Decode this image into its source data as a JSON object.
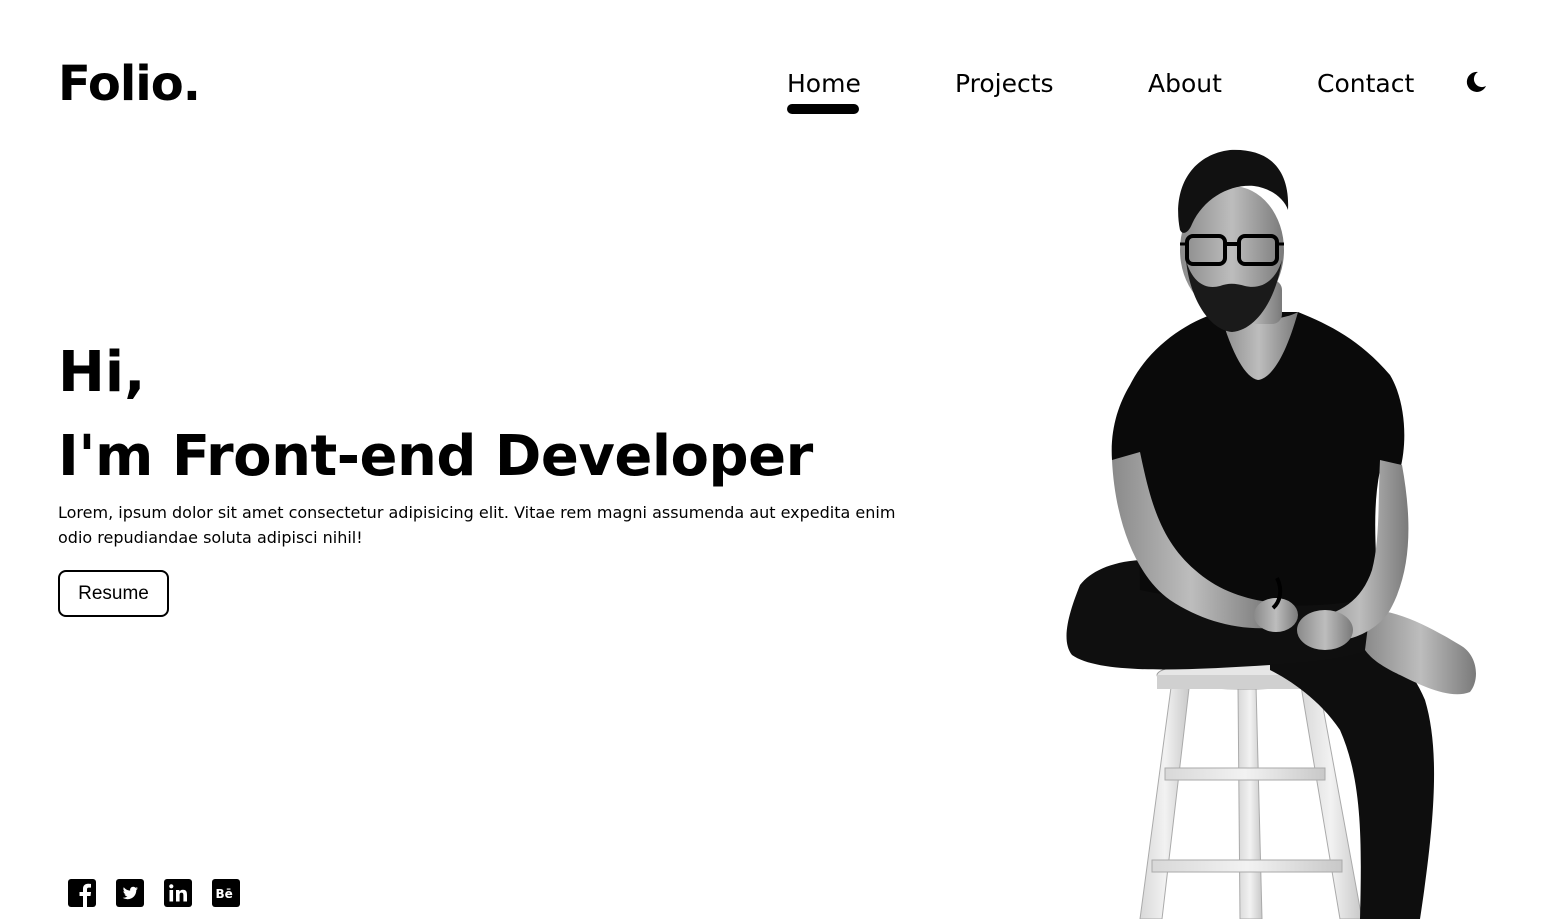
{
  "brand": {
    "logo_text": "Folio."
  },
  "nav": {
    "items": [
      {
        "label": "Home",
        "active": true
      },
      {
        "label": "Projects",
        "active": false
      },
      {
        "label": "About",
        "active": false
      },
      {
        "label": "Contact",
        "active": false
      }
    ],
    "theme_toggle_icon": "moon-icon"
  },
  "hero": {
    "greeting": "Hi,",
    "title": "I'm Front-end Developer",
    "description": "Lorem, ipsum dolor sit amet consectetur adipisicing elit. Vitae rem magni assumenda aut expedita enim odio repudiandae soluta adipisci nihil!",
    "resume_label": "Resume"
  },
  "social": [
    {
      "icon": "facebook-icon"
    },
    {
      "icon": "twitter-icon"
    },
    {
      "icon": "linkedin-icon"
    },
    {
      "icon": "behance-icon"
    }
  ],
  "portrait": {
    "icon": "developer-portrait"
  },
  "colors": {
    "background": "#ffffff",
    "text": "#000000",
    "accent": "#000000"
  }
}
